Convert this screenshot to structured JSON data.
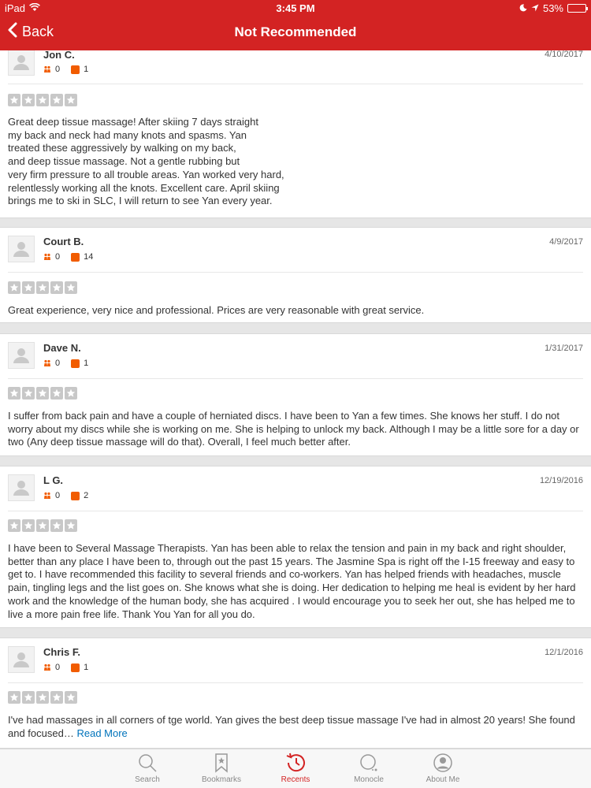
{
  "statusbar": {
    "device": "iPad",
    "time": "3:45 PM",
    "battery": "53%",
    "battery_level": 0.53
  },
  "nav": {
    "back_label": "Back",
    "title": "Not Recommended"
  },
  "reviews": [
    {
      "name": "Jon C.",
      "friends": "0",
      "reviews": "1",
      "date": "4/10/2017",
      "text": "Great deep tissue massage! After skiing 7 days straight\nmy back and neck had many knots and spasms. Yan\ntreated these aggressively by walking on my back,\nand deep tissue massage. Not a gentle rubbing but\nvery firm pressure to all trouble areas. Yan worked very hard,\nrelentlessly working all the knots. Excellent care. April skiing\nbrings me to ski in SLC, I will return to see Yan every year."
    },
    {
      "name": "Court B.",
      "friends": "0",
      "reviews": "14",
      "date": "4/9/2017",
      "text": "Great experience, very nice and professional. Prices are very reasonable with great service."
    },
    {
      "name": "Dave N.",
      "friends": "0",
      "reviews": "1",
      "date": "1/31/2017",
      "text": "I suffer from back pain and have a couple of herniated discs. I have been to Yan a few times.  She knows her stuff.  I do not worry about my discs while she is working on me.  She is helping to unlock my back.  Although I may be a little sore for a day or two (Any deep tissue massage will do that).  Overall, I feel much better after."
    },
    {
      "name": "L G.",
      "friends": "0",
      "reviews": "2",
      "date": "12/19/2016",
      "text": "I have been to Several Massage Therapists. Yan has been able to relax the tension and pain in my back and right shoulder, better than any place I have been to, through out the past 15 years. The Jasmine Spa is right off the I-15 freeway and easy to get to. I have recommended this facility to several friends and co-workers. Yan has helped friends with headaches, muscle pain, tingling legs and the list goes on.  She knows what she is doing. Her dedication to helping me heal is evident by her hard work and the knowledge of the human body, she has acquired . I would encourage you to seek her out, she has helped me to live a more pain free life. Thank You Yan for all you do."
    },
    {
      "name": "Chris F.",
      "friends": "0",
      "reviews": "1",
      "date": "12/1/2016",
      "text": "I've had massages in all corners of tge world.  Yan gives the best deep tissue massage I've had in almost 20 years! She found and focused…",
      "read_more": "Read More"
    }
  ],
  "tabs": [
    {
      "label": "Search",
      "icon": "search-icon"
    },
    {
      "label": "Bookmarks",
      "icon": "bookmark-icon"
    },
    {
      "label": "Recents",
      "icon": "recents-icon",
      "active": true
    },
    {
      "label": "Monocle",
      "icon": "monocle-icon"
    },
    {
      "label": "About Me",
      "icon": "about-me-icon"
    }
  ],
  "colors": {
    "brand": "#d32323",
    "link": "#0073bb",
    "stat_orange": "#f15c00"
  }
}
